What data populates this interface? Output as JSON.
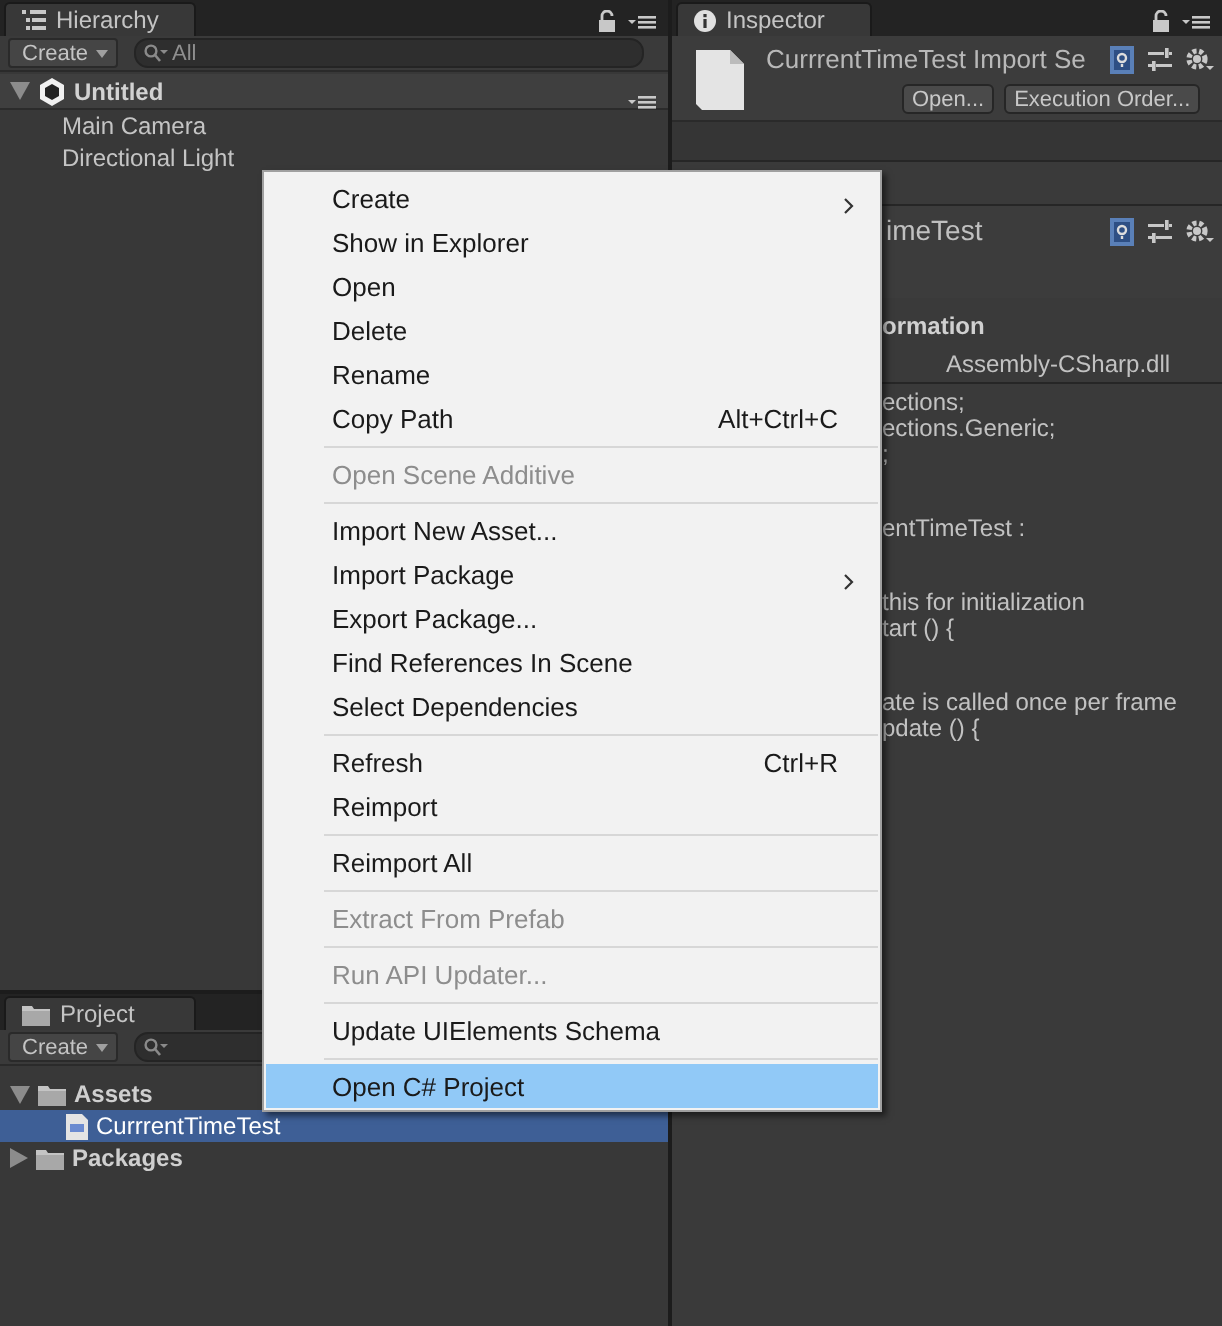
{
  "hierarchy": {
    "tab": "Hierarchy",
    "create_button": "Create",
    "search": {
      "placeholder": "All"
    },
    "scene": {
      "name": "Untitled",
      "expanded": true,
      "children": [
        {
          "name": "Main Camera"
        },
        {
          "name": "Directional Light"
        }
      ]
    }
  },
  "inspector": {
    "tab": "Inspector",
    "title": "CurrrentTimeTest Import Se",
    "buttons": [
      "Open...",
      "Execution Order..."
    ],
    "component_title": "imeTest",
    "section_title": "ormation",
    "assembly": "Assembly-CSharp.dll",
    "code_blocks": [
      [
        "ections;",
        "ections.Generic;",
        ";"
      ],
      [
        "entTimeTest :"
      ],
      [
        "this for initialization",
        "tart () {"
      ],
      [
        "ate is called once per frame",
        "pdate () {"
      ]
    ]
  },
  "project": {
    "tab": "Project",
    "create_button": "Create",
    "tree": [
      {
        "name": "Assets",
        "kind": "folder",
        "expanded": true,
        "selected": false,
        "children": [
          {
            "name": "CurrrentTimeTest",
            "kind": "script",
            "selected": true
          }
        ]
      },
      {
        "name": "Packages",
        "kind": "folder",
        "expanded": false,
        "selected": false
      }
    ]
  },
  "context_menu": {
    "items": [
      {
        "kind": "item",
        "label": "Create",
        "submenu": true,
        "disabled": false,
        "selected": false
      },
      {
        "kind": "item",
        "label": "Show in Explorer",
        "disabled": false,
        "selected": false
      },
      {
        "kind": "item",
        "label": "Open",
        "disabled": false,
        "selected": false
      },
      {
        "kind": "item",
        "label": "Delete",
        "disabled": false,
        "selected": false
      },
      {
        "kind": "item",
        "label": "Rename",
        "disabled": false,
        "selected": false
      },
      {
        "kind": "item",
        "label": "Copy Path",
        "shortcut": "Alt+Ctrl+C",
        "disabled": false,
        "selected": false
      },
      {
        "kind": "separator"
      },
      {
        "kind": "item",
        "label": "Open Scene Additive",
        "disabled": true,
        "selected": false
      },
      {
        "kind": "separator"
      },
      {
        "kind": "item",
        "label": "Import New Asset...",
        "disabled": false,
        "selected": false
      },
      {
        "kind": "item",
        "label": "Import Package",
        "submenu": true,
        "disabled": false,
        "selected": false
      },
      {
        "kind": "item",
        "label": "Export Package...",
        "disabled": false,
        "selected": false
      },
      {
        "kind": "item",
        "label": "Find References In Scene",
        "disabled": false,
        "selected": false
      },
      {
        "kind": "item",
        "label": "Select Dependencies",
        "disabled": false,
        "selected": false
      },
      {
        "kind": "separator"
      },
      {
        "kind": "item",
        "label": "Refresh",
        "shortcut": "Ctrl+R",
        "disabled": false,
        "selected": false
      },
      {
        "kind": "item",
        "label": "Reimport",
        "disabled": false,
        "selected": false
      },
      {
        "kind": "separator"
      },
      {
        "kind": "item",
        "label": "Reimport All",
        "disabled": false,
        "selected": false
      },
      {
        "kind": "separator"
      },
      {
        "kind": "item",
        "label": "Extract From Prefab",
        "disabled": true,
        "selected": false
      },
      {
        "kind": "separator"
      },
      {
        "kind": "item",
        "label": "Run API Updater...",
        "disabled": true,
        "selected": false
      },
      {
        "kind": "separator"
      },
      {
        "kind": "item",
        "label": "Update UIElements Schema",
        "disabled": false,
        "selected": false
      },
      {
        "kind": "separator"
      },
      {
        "kind": "item",
        "label": "Open C# Project",
        "disabled": false,
        "selected": true
      }
    ]
  }
}
